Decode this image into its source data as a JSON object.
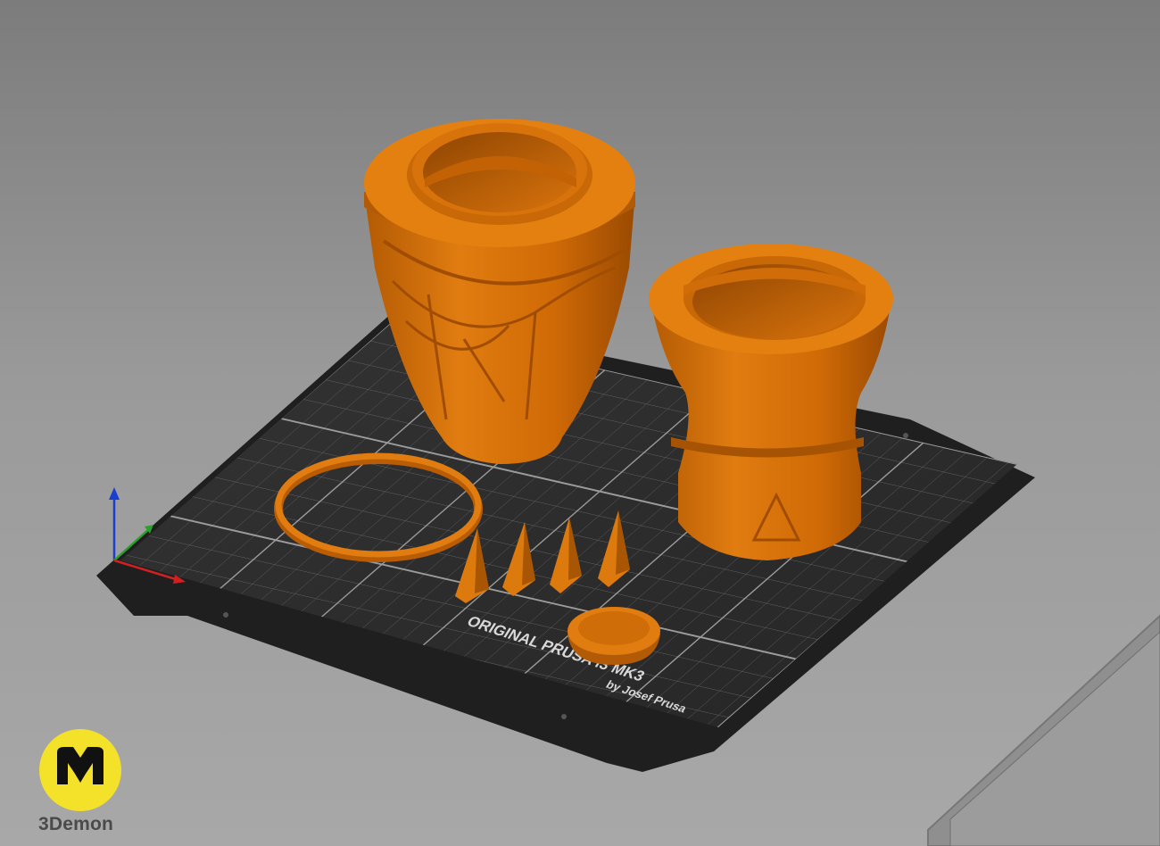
{
  "bed": {
    "brand_line": "ORIGINAL PRUSA i3 MK3",
    "maker_line": "by Josef Prusa"
  },
  "watermark": {
    "brand_name": "3Demon"
  },
  "colors": {
    "background_top": "#7c7c7c",
    "background_bottom": "#a8a8a8",
    "bed_surface": "#2c2c2c",
    "bed_grid": "#7a7a7a",
    "model_orange": "#d8710a",
    "model_orange_shadow": "#a65404",
    "axis_x": "#d22020",
    "axis_y": "#2aa02a",
    "axis_z": "#1a3fd0",
    "logo_yellow": "#f4e12a"
  },
  "objects": [
    "large-vase-body",
    "small-cup-body",
    "thin-ring",
    "spike-1",
    "spike-2",
    "spike-3",
    "spike-4",
    "round-cap"
  ]
}
